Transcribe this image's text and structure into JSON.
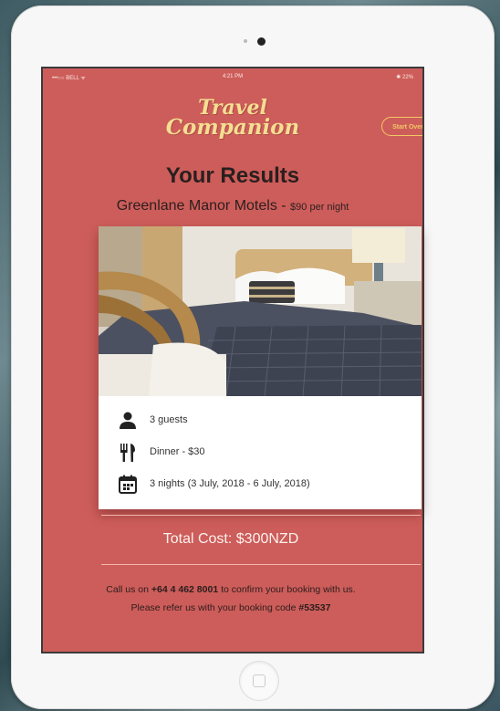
{
  "status_bar": {
    "carrier": "•••○○ BELL ᯤ",
    "time": "4:21 PM",
    "battery": "✱ 22%"
  },
  "logo": {
    "line1": "Travel",
    "line2": "Companion"
  },
  "start_over_label": "Start Over",
  "page_title": "Your Results",
  "hotel": {
    "name": "Greenlane Manor Motels - ",
    "price": "$90 per night"
  },
  "details": {
    "guests": "3 guests",
    "dinner": "Dinner - $30",
    "nights": "3 nights (3 July, 2018 - 6 July, 2018)"
  },
  "total": "Total Cost: $300NZD",
  "contact": {
    "pre": "Call us on ",
    "phone": "+64 4 462 8001",
    "post": " to confirm your booking with us.",
    "code_pre": "Please refer us with your booking code ",
    "code": "#53537"
  },
  "icons": {
    "guests": "person-icon",
    "dinner": "cutlery-icon",
    "nights": "calendar-icon"
  },
  "colors": {
    "screen_bg": "#cd5d5a",
    "logo": "#f4de92",
    "accent": "#f4c766",
    "text_dark": "#2a1f1f"
  }
}
